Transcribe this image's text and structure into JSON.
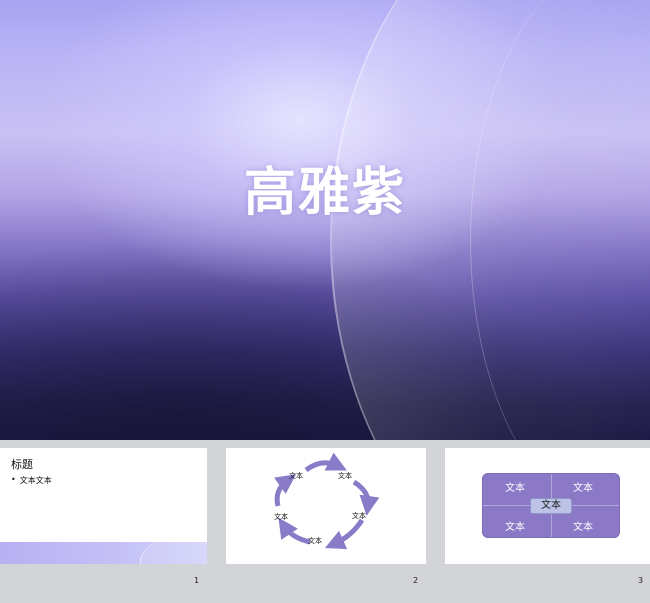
{
  "main_slide": {
    "title": "高雅紫"
  },
  "thumbnails": [
    {
      "number": "1",
      "title": "标题",
      "bullet_marker": "•",
      "bullet_text": "文本文本"
    },
    {
      "number": "2",
      "cycle_labels": [
        "文本",
        "文本",
        "文本",
        "文本",
        "文本",
        "文本"
      ]
    },
    {
      "number": "3",
      "cells": [
        "文本",
        "文本",
        "文本",
        "文本"
      ],
      "center_label": "文本"
    }
  ],
  "colors": {
    "accent_purple": "#8b78c6",
    "cycle_arrow": "#8a7bc8",
    "strip_background": "#d3d4d8"
  }
}
